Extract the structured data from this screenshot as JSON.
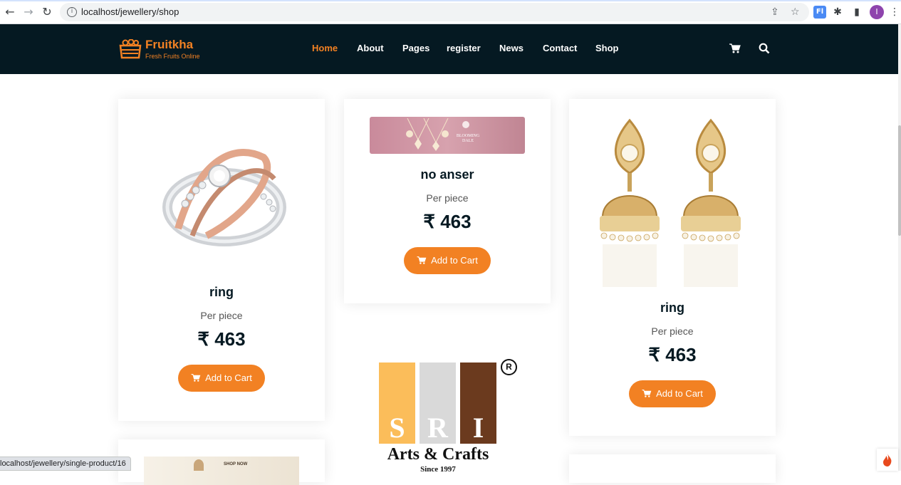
{
  "browser": {
    "url": "localhost/jewellery/shop",
    "avatar_letter": "I",
    "status_url": "localhost/jewellery/single-product/16"
  },
  "site": {
    "brand": "Fruitkha",
    "tagline": "Fresh Fruits Online",
    "accent_color": "#f28123",
    "header_bg": "#051922",
    "nav": [
      {
        "label": "Home",
        "active": true
      },
      {
        "label": "About"
      },
      {
        "label": "Pages"
      },
      {
        "label": "register"
      },
      {
        "label": "News"
      },
      {
        "label": "Contact"
      },
      {
        "label": "Shop"
      }
    ],
    "icons": [
      "cart-icon",
      "search-icon"
    ]
  },
  "products": [
    {
      "name": "ring",
      "unit": "Per piece",
      "price": "₹ 463",
      "button": "Add to Cart",
      "image": "ring"
    },
    {
      "name": "no anser",
      "unit": "Per piece",
      "price": "₹ 463",
      "button": "Add to Cart",
      "image": "jewellery-banner"
    },
    {
      "name": "ring",
      "unit": "Per piece",
      "price": "₹ 463",
      "button": "Add to Cart",
      "image": "earrings"
    }
  ],
  "logo_block": {
    "letters": [
      "S",
      "R",
      "I"
    ],
    "title": "Arts & Crafts",
    "since": "Since 1997",
    "registered": "R"
  },
  "banner_text": {
    "brand": "BLOOMING DALE",
    "partial": "SHOP NOW"
  }
}
